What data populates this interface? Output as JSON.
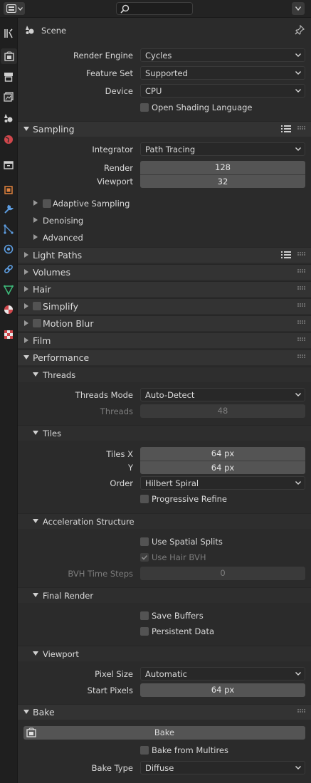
{
  "header": {
    "editor_type_icon": "properties-editor-icon",
    "search_placeholder": ""
  },
  "tabs": [
    {
      "name": "tool-icon",
      "color": "#cfcfcf"
    },
    {
      "name": "render-icon",
      "color": "#cfcfcf",
      "active": true
    },
    {
      "name": "output-icon",
      "color": "#cfcfcf"
    },
    {
      "name": "view-layer-icon",
      "color": "#cfcfcf"
    },
    {
      "name": "scene-icon",
      "color": "#cfcfcf"
    },
    {
      "name": "world-icon",
      "color": "#d0474c"
    },
    {
      "name": "collection-icon",
      "color": "#cfcfcf"
    },
    {
      "name": "object-icon",
      "color": "#e0823d"
    },
    {
      "name": "modifier-icon",
      "color": "#5d9de0"
    },
    {
      "name": "particles-icon",
      "color": "#5d9de0"
    },
    {
      "name": "physics-icon",
      "color": "#5d9de0"
    },
    {
      "name": "constraints-icon",
      "color": "#5d9de0"
    },
    {
      "name": "data-icon",
      "color": "#3dbb7a"
    },
    {
      "name": "material-icon",
      "color": "#d0474c"
    },
    {
      "name": "texture-icon",
      "color": "#d0474c"
    }
  ],
  "context": {
    "label": "Scene"
  },
  "render_settings": {
    "render_engine_label": "Render Engine",
    "render_engine_value": "Cycles",
    "feature_set_label": "Feature Set",
    "feature_set_value": "Supported",
    "device_label": "Device",
    "device_value": "CPU",
    "osl_label": "Open Shading Language"
  },
  "sampling": {
    "title": "Sampling",
    "integrator_label": "Integrator",
    "integrator_value": "Path Tracing",
    "render_label": "Render",
    "render_value": "128",
    "viewport_label": "Viewport",
    "viewport_value": "32",
    "adaptive_sampling": "Adaptive Sampling",
    "denoising": "Denoising",
    "advanced": "Advanced"
  },
  "panels": {
    "light_paths": "Light Paths",
    "volumes": "Volumes",
    "hair": "Hair",
    "simplify": "Simplify",
    "motion_blur": "Motion Blur",
    "film": "Film",
    "performance": "Performance"
  },
  "threads": {
    "title": "Threads",
    "mode_label": "Threads Mode",
    "mode_value": "Auto-Detect",
    "threads_label": "Threads",
    "threads_value": "48"
  },
  "tiles": {
    "title": "Tiles",
    "x_label": "Tiles X",
    "x_value": "64 px",
    "y_label": "Y",
    "y_value": "64 px",
    "order_label": "Order",
    "order_value": "Hilbert Spiral",
    "progressive_label": "Progressive Refine"
  },
  "acceleration": {
    "title": "Acceleration Structure",
    "spatial_splits_label": "Use Spatial Splits",
    "hair_bvh_label": "Use Hair BVH",
    "hair_bvh_checked": true,
    "bvh_steps_label": "BVH Time Steps",
    "bvh_steps_value": "0"
  },
  "final_render": {
    "title": "Final Render",
    "save_buffers_label": "Save Buffers",
    "persistent_data_label": "Persistent Data"
  },
  "viewport": {
    "title": "Viewport",
    "pixel_size_label": "Pixel Size",
    "pixel_size_value": "Automatic",
    "start_pixels_label": "Start Pixels",
    "start_pixels_value": "64 px"
  },
  "bake": {
    "title": "Bake",
    "button_label": "Bake",
    "multires_label": "Bake from Multires",
    "bake_type_label": "Bake Type",
    "bake_type_value": "Diffuse"
  },
  "colors": {
    "background": "#2b2b2b",
    "header": "#333333",
    "field": "#545454",
    "dropdown": "#282828"
  }
}
